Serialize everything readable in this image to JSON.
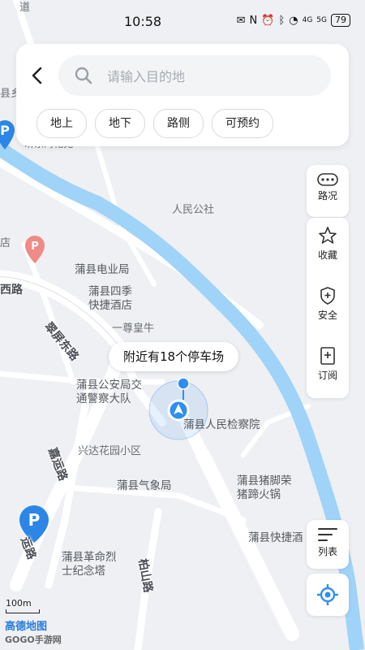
{
  "status_bar": {
    "time": "10:58",
    "battery": "79",
    "signal1": "4G",
    "signal2": "5G"
  },
  "search": {
    "placeholder": "请输入目的地",
    "value": ""
  },
  "filters": [
    "地上",
    "地下",
    "路侧",
    "可预约"
  ],
  "tools": {
    "traffic": "路况",
    "favorite": "收藏",
    "safety": "安全",
    "subscribe": "订阅",
    "list": "列表"
  },
  "callout": "附近有18个停车场",
  "map_labels": {
    "people_park": "人民公社",
    "power_bureau": "蒲县电业局",
    "hotel": "蒲县四季\n快捷酒店",
    "yizun": "一尊皇牛",
    "police": "蒲县公安局交\n通警察大队",
    "procuratorate": "蒲县人民检察院",
    "xingda": "兴达花园小区",
    "weather": "蒲县气象局",
    "hotpot": "蒲县猪脚荣\n猪蹄火锅",
    "express_hotel": "蒲县快捷酒",
    "martyrs": "蒲县革命烈\n士纪念塔",
    "county": "县乡",
    "dao": "道",
    "dian": "店",
    "top_partial": "昕东湾花苑"
  },
  "road_labels": {
    "west": "西路",
    "cuiping_east": "翠屏东路",
    "jiayun_1": "嘉运路",
    "jiayun_2": "运路",
    "boshan": "柏山路"
  },
  "scale": "100m",
  "logo": {
    "main": "高德地图",
    "sub": "GOGO手游网"
  },
  "colors": {
    "river": "#9fd3f7",
    "accent": "#2f8ff0",
    "pin": "#2b86e6"
  }
}
